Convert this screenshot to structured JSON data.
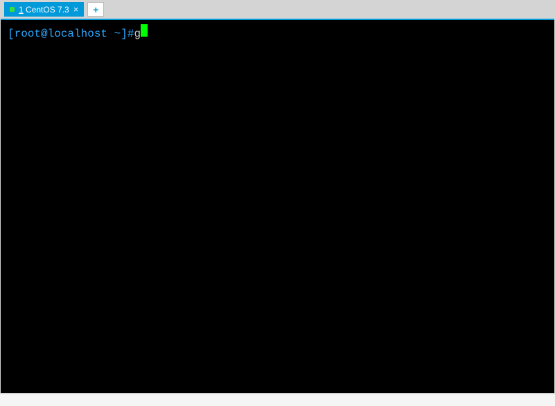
{
  "tabs": [
    {
      "number": "1",
      "title": "CentOS 7.3",
      "status": "connected"
    }
  ],
  "newTabSymbol": "+",
  "closeSymbol": "×",
  "terminal": {
    "prompt": "[root@localhost ~]#",
    "command": "g"
  }
}
